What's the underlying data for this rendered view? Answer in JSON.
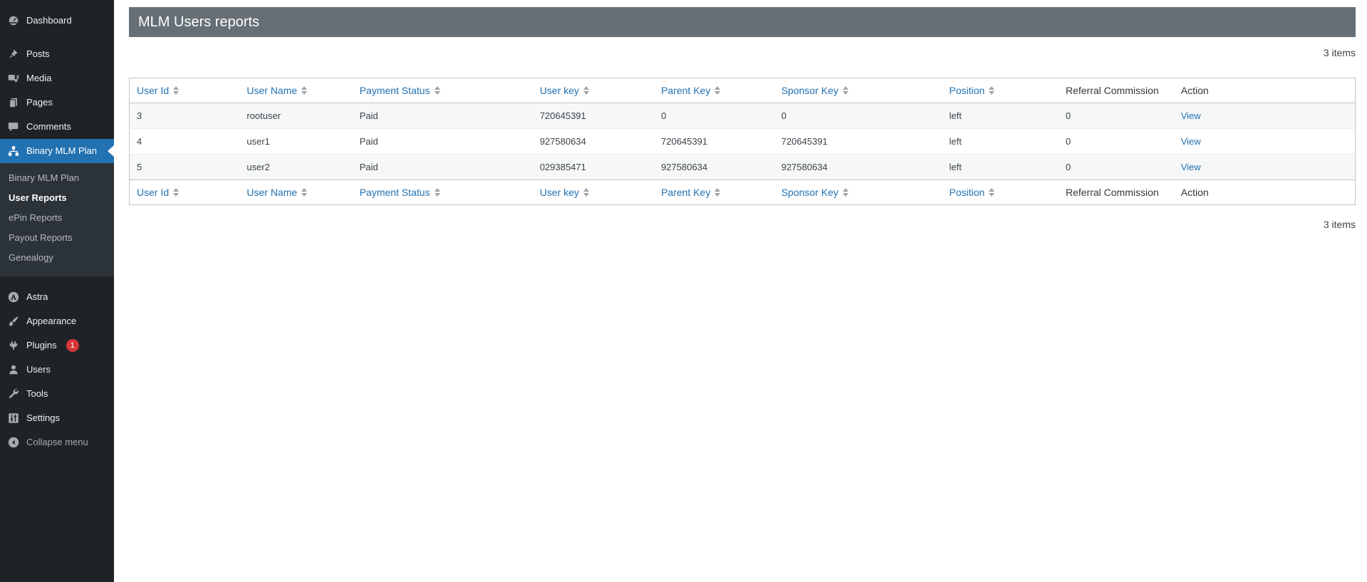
{
  "sidebar": {
    "top_items": [
      {
        "label": "Dashboard"
      },
      {
        "label": "Posts"
      },
      {
        "label": "Media"
      },
      {
        "label": "Pages"
      },
      {
        "label": "Comments"
      },
      {
        "label": "Binary MLM Plan"
      }
    ],
    "submenu": {
      "items": [
        {
          "label": "Binary MLM Plan"
        },
        {
          "label": "User Reports"
        },
        {
          "label": "ePin Reports"
        },
        {
          "label": "Payout Reports"
        },
        {
          "label": "Genealogy"
        }
      ]
    },
    "bottom_items": [
      {
        "label": "Astra"
      },
      {
        "label": "Appearance"
      },
      {
        "label": "Plugins",
        "badge": "1"
      },
      {
        "label": "Users"
      },
      {
        "label": "Tools"
      },
      {
        "label": "Settings"
      }
    ],
    "collapse_label": "Collapse menu"
  },
  "page": {
    "title": "MLM Users reports",
    "items_count_top": "3 items",
    "items_count_bottom": "3 items"
  },
  "table": {
    "columns": [
      {
        "label": "User Id",
        "sortable": true
      },
      {
        "label": "User Name",
        "sortable": true
      },
      {
        "label": "Payment Status",
        "sortable": true
      },
      {
        "label": "User key",
        "sortable": true
      },
      {
        "label": "Parent Key",
        "sortable": true
      },
      {
        "label": "Sponsor Key",
        "sortable": true
      },
      {
        "label": "Position",
        "sortable": true
      },
      {
        "label": "Referral Commission",
        "sortable": false
      },
      {
        "label": "Action",
        "sortable": false
      }
    ],
    "rows": [
      {
        "cells": [
          "3",
          "rootuser",
          "Paid",
          "720645391",
          "0",
          "0",
          "left",
          "0",
          "View"
        ]
      },
      {
        "cells": [
          "4",
          "user1",
          "Paid",
          "927580634",
          "720645391",
          "720645391",
          "left",
          "0",
          "View"
        ]
      },
      {
        "cells": [
          "5",
          "user2",
          "Paid",
          "029385471",
          "927580634",
          "927580634",
          "left",
          "0",
          "View"
        ]
      }
    ]
  },
  "colors": {
    "accent_blue": "#2271b1",
    "sidebar_bg": "#1d2327",
    "submenu_bg": "#2c3338",
    "active_item_bg": "#2271b1",
    "title_bar_bg": "#666f75",
    "badge_red": "#d63638",
    "stripe_row_bg": "#f6f7f7"
  }
}
